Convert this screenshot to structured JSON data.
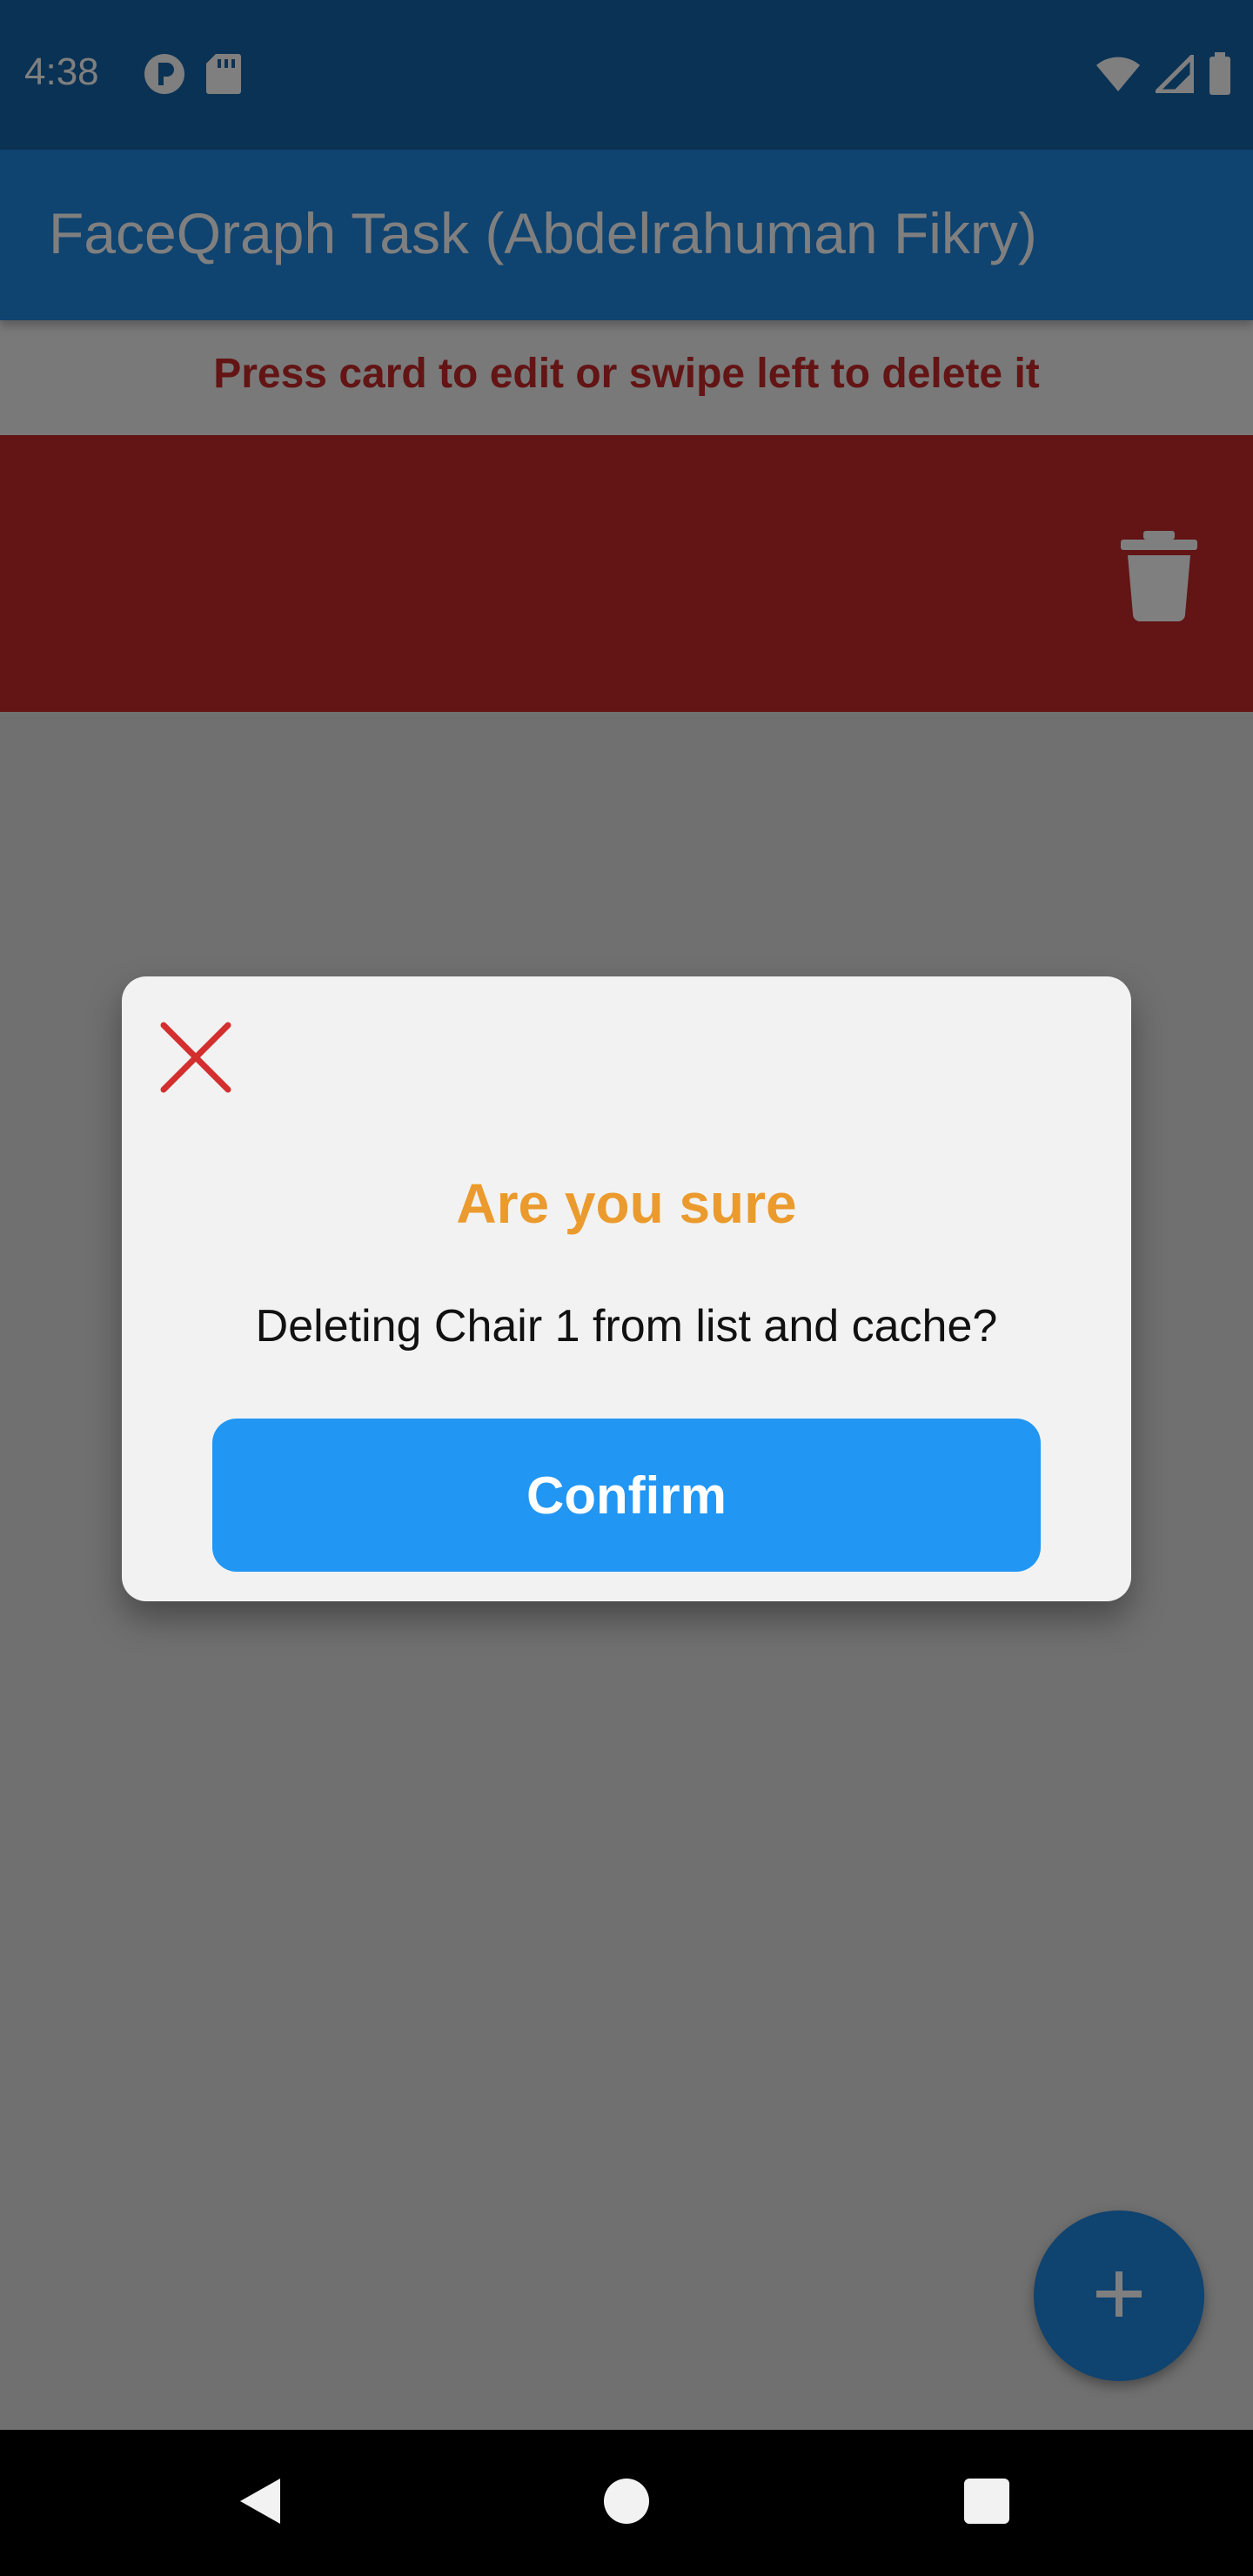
{
  "status_bar": {
    "time": "4:38",
    "icons_left": [
      "podcast-icon",
      "sd-card-icon"
    ],
    "icons_right": [
      "wifi-icon",
      "signal-icon",
      "battery-icon"
    ]
  },
  "app_bar": {
    "title": "FaceQraph Task (Abdelrahuman Fikry)",
    "color": "#1f87e0"
  },
  "hint": {
    "text": "Press card to edit or swipe left to delete it",
    "color": "#c62828"
  },
  "swiped_card": {
    "background": "#c62828",
    "icon": "trash-icon"
  },
  "dialog": {
    "close_icon": "close-icon",
    "title": "Are you sure",
    "title_color": "#eb9a2d",
    "message": "Deleting Chair 1 from list and cache?",
    "confirm_label": "Confirm",
    "confirm_color": "#2196f3"
  },
  "fab": {
    "icon": "plus-icon"
  },
  "nav_bar": {
    "buttons": [
      "back-icon",
      "home-icon",
      "recent-apps-icon"
    ]
  }
}
